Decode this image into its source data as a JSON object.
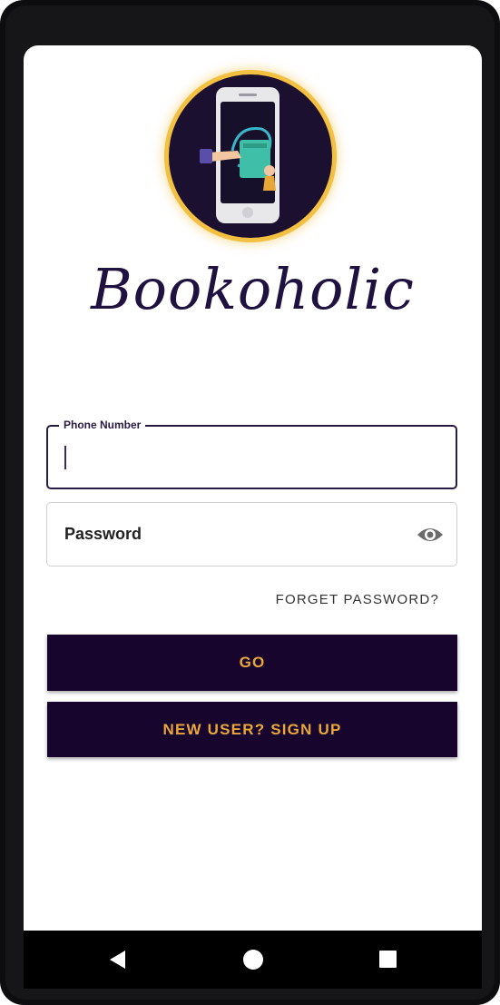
{
  "app": {
    "brand_name": "Bookoholic",
    "brand_color": "#1f1240",
    "accent_color": "#e9a73a",
    "button_color": "#17052e"
  },
  "login_form": {
    "phone_label": "Phone Number",
    "phone_value": "",
    "password_placeholder": "Password",
    "password_toggle_icon": "eye-icon",
    "forgot_password": "FORGET PASSWORD?",
    "go_button": "GO",
    "signup_button": "NEW USER? SIGN UP"
  },
  "navigation_bar": {
    "items": [
      "back-icon",
      "home-icon",
      "recent-apps-icon"
    ]
  }
}
